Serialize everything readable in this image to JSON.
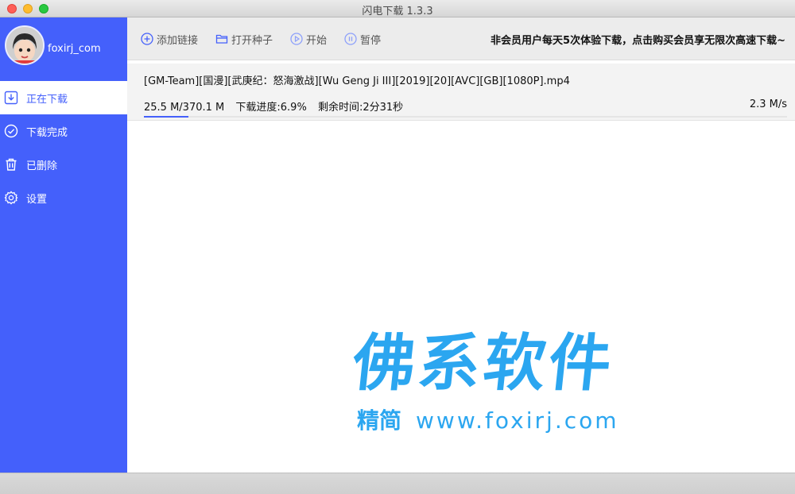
{
  "window": {
    "title": "闪电下载 1.3.3"
  },
  "user": {
    "name": "foxirj_com"
  },
  "sidebar": {
    "items": [
      {
        "label": "正在下载",
        "icon": "download-icon",
        "active": true
      },
      {
        "label": "下载完成",
        "icon": "check-circle-icon",
        "active": false
      },
      {
        "label": "已删除",
        "icon": "trash-icon",
        "active": false
      },
      {
        "label": "设置",
        "icon": "gear-icon",
        "active": false
      }
    ]
  },
  "toolbar": {
    "add_label": "添加链接",
    "torrent_label": "打开种子",
    "start_label": "开始",
    "pause_label": "暂停",
    "promo": "非会员用户每天5次体验下载，点击购买会员享无限次高速下载~"
  },
  "task": {
    "name": "[GM-Team][国漫][武庚纪：怒海激战][Wu Geng Ji III][2019][20][AVC][GB][1080P].mp4",
    "size": "25.5 M/370.1 M",
    "progress_text": "下载进度:6.9%",
    "progress": 0.069,
    "remaining": "剩余时间:2分31秒",
    "speed": "2.3 M/s"
  },
  "watermark": {
    "brand": "佛系软件",
    "tag": "精简",
    "url": "www.foxirj.com"
  },
  "colors": {
    "accent": "#4460fb",
    "watermark": "#2ba6f0"
  }
}
